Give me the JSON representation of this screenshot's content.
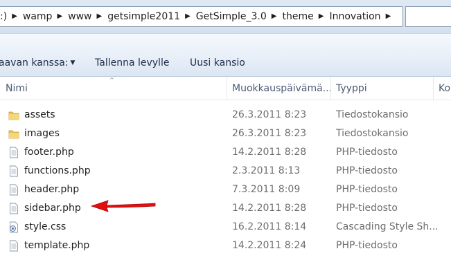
{
  "address": {
    "crumbs": [
      ":)",
      "wamp",
      "www",
      "getsimple2011",
      "GetSimple_3.0",
      "theme",
      "Innovation"
    ]
  },
  "toolbar": {
    "share_label": "aavan kanssa:",
    "burn_label": "Tallenna levylle",
    "new_folder_label": "Uusi kansio"
  },
  "columns": {
    "name": "Nimi",
    "date": "Muokkauspäivämä...",
    "type": "Tyyppi",
    "size": "Ko"
  },
  "files": [
    {
      "name": "assets",
      "date": "26.3.2011 8:23",
      "type": "Tiedostokansio",
      "icon": "folder-icon"
    },
    {
      "name": "images",
      "date": "26.3.2011 8:23",
      "type": "Tiedostokansio",
      "icon": "folder-icon"
    },
    {
      "name": "footer.php",
      "date": "14.2.2011 8:28",
      "type": "PHP-tiedosto",
      "icon": "file-icon"
    },
    {
      "name": "functions.php",
      "date": "2.3.2011 8:13",
      "type": "PHP-tiedosto",
      "icon": "file-icon"
    },
    {
      "name": "header.php",
      "date": "7.3.2011 8:09",
      "type": "PHP-tiedosto",
      "icon": "file-icon"
    },
    {
      "name": "sidebar.php",
      "date": "14.2.2011 8:28",
      "type": "PHP-tiedosto",
      "icon": "file-icon"
    },
    {
      "name": "style.css",
      "date": "16.2.2011 8:14",
      "type": "Cascading Style Sh...",
      "icon": "css-file-icon"
    },
    {
      "name": "template.php",
      "date": "14.2.2011 8:24",
      "type": "PHP-tiedosto",
      "icon": "file-icon"
    }
  ],
  "colors": {
    "annotation_arrow": "#e01010",
    "folder": "#e8c35a"
  }
}
